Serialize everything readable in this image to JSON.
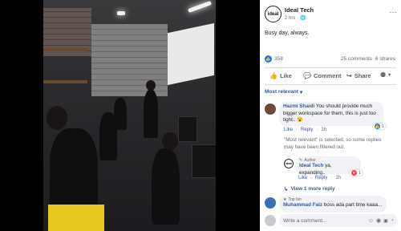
{
  "post": {
    "author": "Ideal Tech",
    "logo_text": "ideal",
    "time": "2 hrs",
    "caption": "Busy day, always."
  },
  "stats": {
    "reactions": "358",
    "comments": "25 comments",
    "shares": "6 shares"
  },
  "actions": {
    "like": "Like",
    "comment": "Comment",
    "share": "Share"
  },
  "sort": {
    "label": "Most relevant",
    "arrow": "▾"
  },
  "comments": [
    {
      "author": "Hazmi Shaidi",
      "text": "You should provide much bigger workspace for them, this is just too tight..",
      "emoji": "😮",
      "like": "Like",
      "reply": "Reply",
      "age": "1h",
      "reaction_count": "1"
    }
  ],
  "filter_note": "\"Most relevant\" is selected, so some replies may have been filtered out.",
  "reply": {
    "author_badge": "Author",
    "author": "Ideal Tech",
    "text": "ya, expanding..",
    "like": "Like",
    "reply": "Reply",
    "age": "1h",
    "reaction_count": "1"
  },
  "view_more": "View 1 more reply",
  "next_comment": {
    "badge": "Top fan",
    "author": "Muhammad Faiz",
    "text": "boss ada part time kaaa..."
  },
  "composer": {
    "placeholder": "Write a comment..."
  },
  "colors": {
    "like_blue": "#1877f2",
    "heart_red": "#f33e58",
    "link": "#385898"
  }
}
